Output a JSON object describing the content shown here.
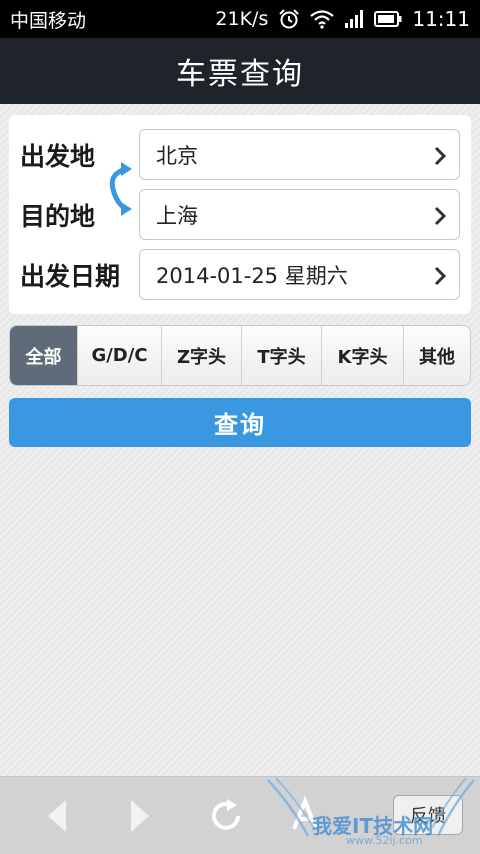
{
  "status_bar": {
    "carrier": "中国移动",
    "speed": "21K/s",
    "time": "11:11"
  },
  "header": {
    "title": "车票查询"
  },
  "form": {
    "departure": {
      "label": "出发地",
      "value": "北京"
    },
    "destination": {
      "label": "目的地",
      "value": "上海"
    },
    "date": {
      "label": "出发日期",
      "value": "2014-01-25 星期六"
    }
  },
  "filter_tabs": [
    {
      "label": "全部",
      "active": true
    },
    {
      "label": "G/D/C",
      "active": false
    },
    {
      "label": "Z字头",
      "active": false
    },
    {
      "label": "T字头",
      "active": false
    },
    {
      "label": "K字头",
      "active": false
    },
    {
      "label": "其他",
      "active": false
    }
  ],
  "query_button": {
    "label": "查询"
  },
  "bottom_bar": {
    "feedback_label": "反馈"
  },
  "watermark": {
    "text": "我爱IT技术网",
    "sub": "www.52ij.com"
  },
  "colors": {
    "title_bar": "#1e242a",
    "accent": "#3a98e0",
    "active_tab": "#5f6b78"
  }
}
